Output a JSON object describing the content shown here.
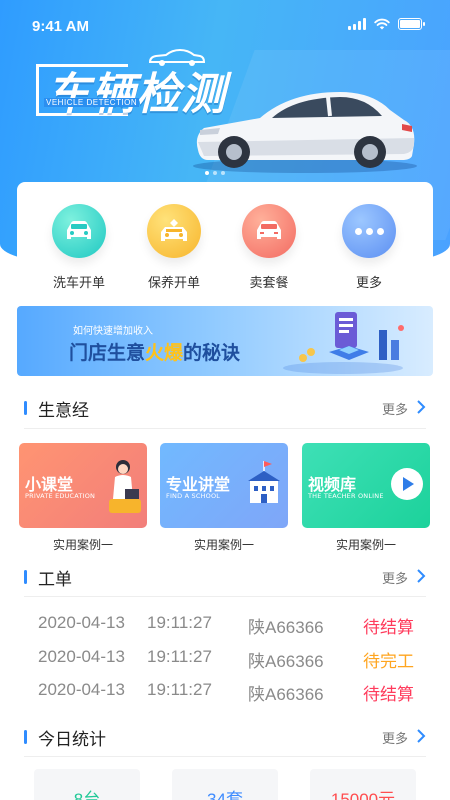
{
  "status_bar": {
    "time": "9:41 AM"
  },
  "banner": {
    "title": "车辆检测",
    "subtitle": "VEHICLE DETECTION",
    "slide_count": 3,
    "active_slide": 0
  },
  "quick_actions": [
    {
      "label": "洗车开单",
      "icon": "car-wash-icon"
    },
    {
      "label": "保养开单",
      "icon": "car-maintenance-icon"
    },
    {
      "label": "卖套餐",
      "icon": "car-package-icon"
    },
    {
      "label": "更多",
      "icon": "more-icon"
    }
  ],
  "promo": {
    "subtitle": "如何快速增加收入",
    "title_before": "门店生意",
    "title_highlight": "火爆",
    "title_after": "的秘诀"
  },
  "business_section": {
    "title": "生意经",
    "more_label": "更多",
    "courses": [
      {
        "title": "小课堂",
        "subtitle": "PRIVATE EDUCATION",
        "caption": "实用案例一"
      },
      {
        "title": "专业讲堂",
        "subtitle": "FIND A SCHOOL",
        "caption": "实用案例一"
      },
      {
        "title": "视频库",
        "subtitle": "THE TEACHER ONLINE",
        "caption": "实用案例一"
      }
    ]
  },
  "orders_section": {
    "title": "工单",
    "more_label": "更多",
    "rows": [
      {
        "date": "2020-04-13",
        "time": "19:11:27",
        "plate": "陕A66366",
        "status": "待结算",
        "status_color": "#ff3b5c"
      },
      {
        "date": "2020-04-13",
        "time": "19:11:27",
        "plate": "陕A66366",
        "status": "待完工",
        "status_color": "#ffa51f"
      },
      {
        "date": "2020-04-13",
        "time": "19:11:27",
        "plate": "陕A66366",
        "status": "待结算",
        "status_color": "#ff3b5c"
      }
    ]
  },
  "stats_section": {
    "title": "今日统计",
    "more_label": "更多",
    "values": [
      "8台",
      "34套",
      "15000元"
    ]
  },
  "colors": {
    "accent": "#2f8cff",
    "hero_start": "#2f9cff",
    "hero_end": "#4aa2ff"
  }
}
